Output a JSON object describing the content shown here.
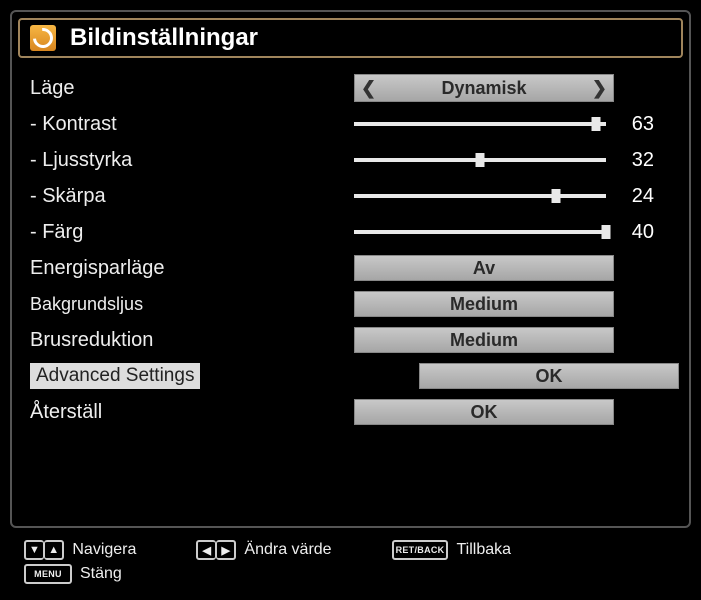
{
  "header": {
    "title": "Bildinställningar"
  },
  "settings": {
    "mode": {
      "label": "Läge",
      "value": "Dynamisk"
    },
    "contrast": {
      "label": "- Kontrast",
      "value": 63,
      "max": 65
    },
    "brightness": {
      "label": "- Ljusstyrka",
      "value": 32,
      "max": 65
    },
    "sharpness": {
      "label": "- Skärpa",
      "value": 24,
      "max": 30
    },
    "color": {
      "label": "- Färg",
      "value": 40,
      "max": 40
    },
    "energy": {
      "label": "Energisparläge",
      "value": "Av"
    },
    "backlight": {
      "label": "Bakgrundsljus",
      "value": "Medium"
    },
    "noise": {
      "label": "Brusreduktion",
      "value": "Medium"
    },
    "advanced": {
      "label": "Advanced Settings",
      "value": "OK"
    },
    "reset": {
      "label": "Återställ",
      "value": "OK"
    }
  },
  "footer": {
    "navigate": "Navigera",
    "change": "Ändra värde",
    "back_key": "RET/BACK",
    "back": "Tillbaka",
    "menu_key": "MENU",
    "close": "Stäng"
  }
}
